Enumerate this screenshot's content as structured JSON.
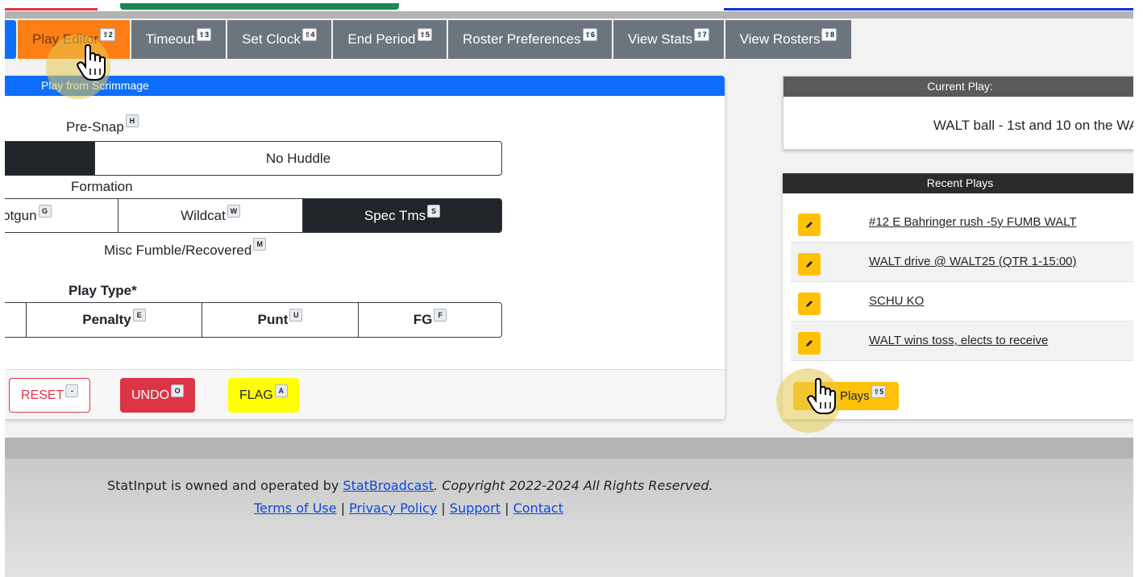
{
  "tabs": [
    {
      "label": "Play Editor",
      "key": "⇧2",
      "active": true
    },
    {
      "label": "Timeout",
      "key": "⇧3"
    },
    {
      "label": "Set Clock",
      "key": "⇧4"
    },
    {
      "label": "End Period",
      "key": "⇧5"
    },
    {
      "label": "Roster Preferences",
      "key": "⇧6"
    },
    {
      "label": "View Stats",
      "key": "⇧7"
    },
    {
      "label": "View Rosters",
      "key": "⇧8"
    }
  ],
  "play_panel": {
    "title": "Play from Scrimmage",
    "presnap": {
      "label": "Pre-Snap",
      "key": "H",
      "no_huddle": "No Huddle"
    },
    "formation": {
      "label": "Formation",
      "options": [
        {
          "label": "otgun",
          "key": "G"
        },
        {
          "label": "Wildcat",
          "key": "W"
        },
        {
          "label": "Spec Tms",
          "key": "S",
          "selected": true
        }
      ]
    },
    "misc_fumble": {
      "label": "Misc Fumble/Recovered",
      "key": "M",
      "checked": false
    },
    "play_type": {
      "label": "Play Type*",
      "options": [
        {
          "label": "Penalty",
          "key": "E"
        },
        {
          "label": "Punt",
          "key": "U"
        },
        {
          "label": "FG",
          "key": "F"
        }
      ]
    },
    "footer": {
      "reset": {
        "label": "RESET",
        "key": "-"
      },
      "undo": {
        "label": "UNDO",
        "key": "O"
      },
      "flag": {
        "label": "FLAG",
        "key": "A"
      }
    }
  },
  "current_play": {
    "title": "Current Play:",
    "text": "WALT ball - 1st and 10 on the WA"
  },
  "recent_plays": {
    "title": "Recent Plays",
    "items": [
      "#12 E Bahringer rush -5y FUMB WALT",
      "WALT drive @ WALT25 (QTR 1-15:00)",
      "SCHU KO",
      "WALT wins toss, elects to receive"
    ],
    "plays_button": {
      "label": "Plays",
      "key": "⇧5"
    }
  },
  "footer": {
    "owned_prefix": "StatInput is owned and operated by ",
    "owner_link": "StatBroadcast",
    "copyright": ". Copyright 2022-2024 All Rights Reserved.",
    "links": [
      "Terms of Use",
      "Privacy Policy",
      "Support",
      "Contact"
    ],
    "separator": " | "
  },
  "colors": {
    "active_tab": "#fd7e14",
    "tab": "#6c757d",
    "panel_header": "#0d6efd",
    "undo": "#dc3545",
    "flag": "#ffff00",
    "edit": "#ffc107"
  }
}
